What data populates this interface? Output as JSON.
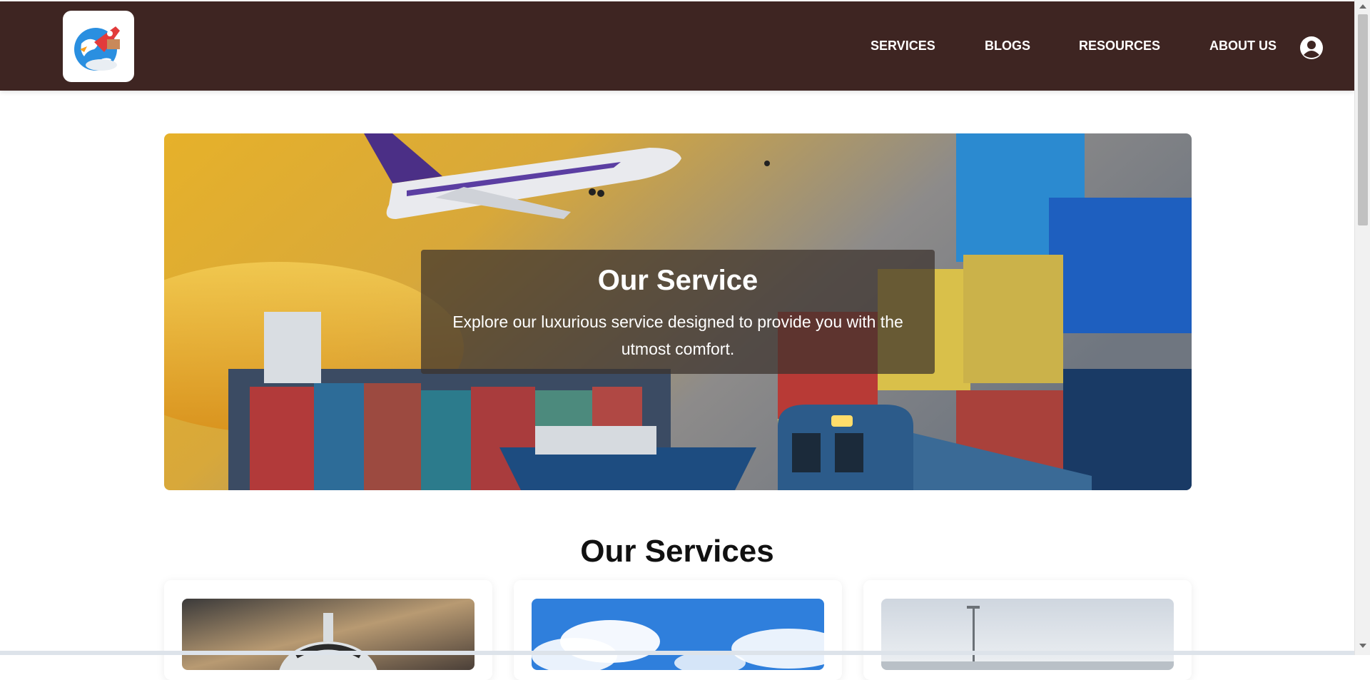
{
  "header": {
    "logo_alt": "logo",
    "nav": [
      {
        "label": "SERVICES"
      },
      {
        "label": "BLOGS"
      },
      {
        "label": "RESOURCES"
      },
      {
        "label": "ABOUT US"
      }
    ],
    "account_icon": "user-circle-icon",
    "background_color": "#3e2522"
  },
  "hero": {
    "title": "Our Service",
    "subtitle": "Explore our luxurious service designed to provide you with the utmost comfort."
  },
  "services": {
    "title": "Our Services",
    "cards": [
      {
        "image": "airplane-front-image"
      },
      {
        "image": "sky-clouds-image"
      },
      {
        "image": "port-yard-image"
      }
    ]
  }
}
